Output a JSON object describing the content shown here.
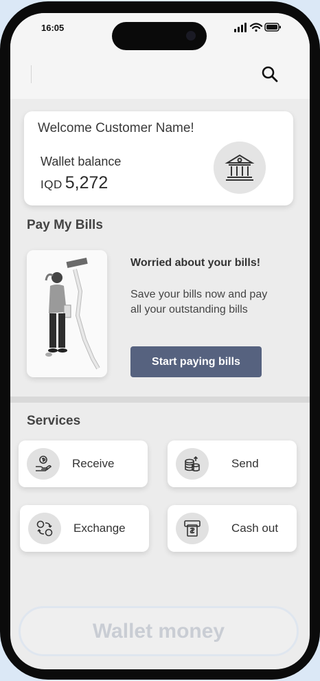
{
  "status_bar": {
    "time": "16:05"
  },
  "welcome": {
    "greeting": "Welcome Customer Name!",
    "wallet_label": "Wallet balance",
    "currency": "IQD",
    "amount": "5,272"
  },
  "bills": {
    "section_title": "Pay My Bills",
    "headline": "Worried about your bills!",
    "description": "Save your bills now and pay all your outstanding bills",
    "button_label": "Start paying bills"
  },
  "services": {
    "section_title": "Services",
    "items": [
      {
        "label": "Receive",
        "icon": "receive-money-icon"
      },
      {
        "label": "Send",
        "icon": "coins-send-icon"
      },
      {
        "label": "Exchange",
        "icon": "exchange-icon"
      },
      {
        "label": "Cash out",
        "icon": "atm-cash-icon"
      }
    ]
  },
  "footer": {
    "wallet_button_label": "Wallet money"
  },
  "colors": {
    "accent_button": "#56627f",
    "background": "#ececec"
  }
}
